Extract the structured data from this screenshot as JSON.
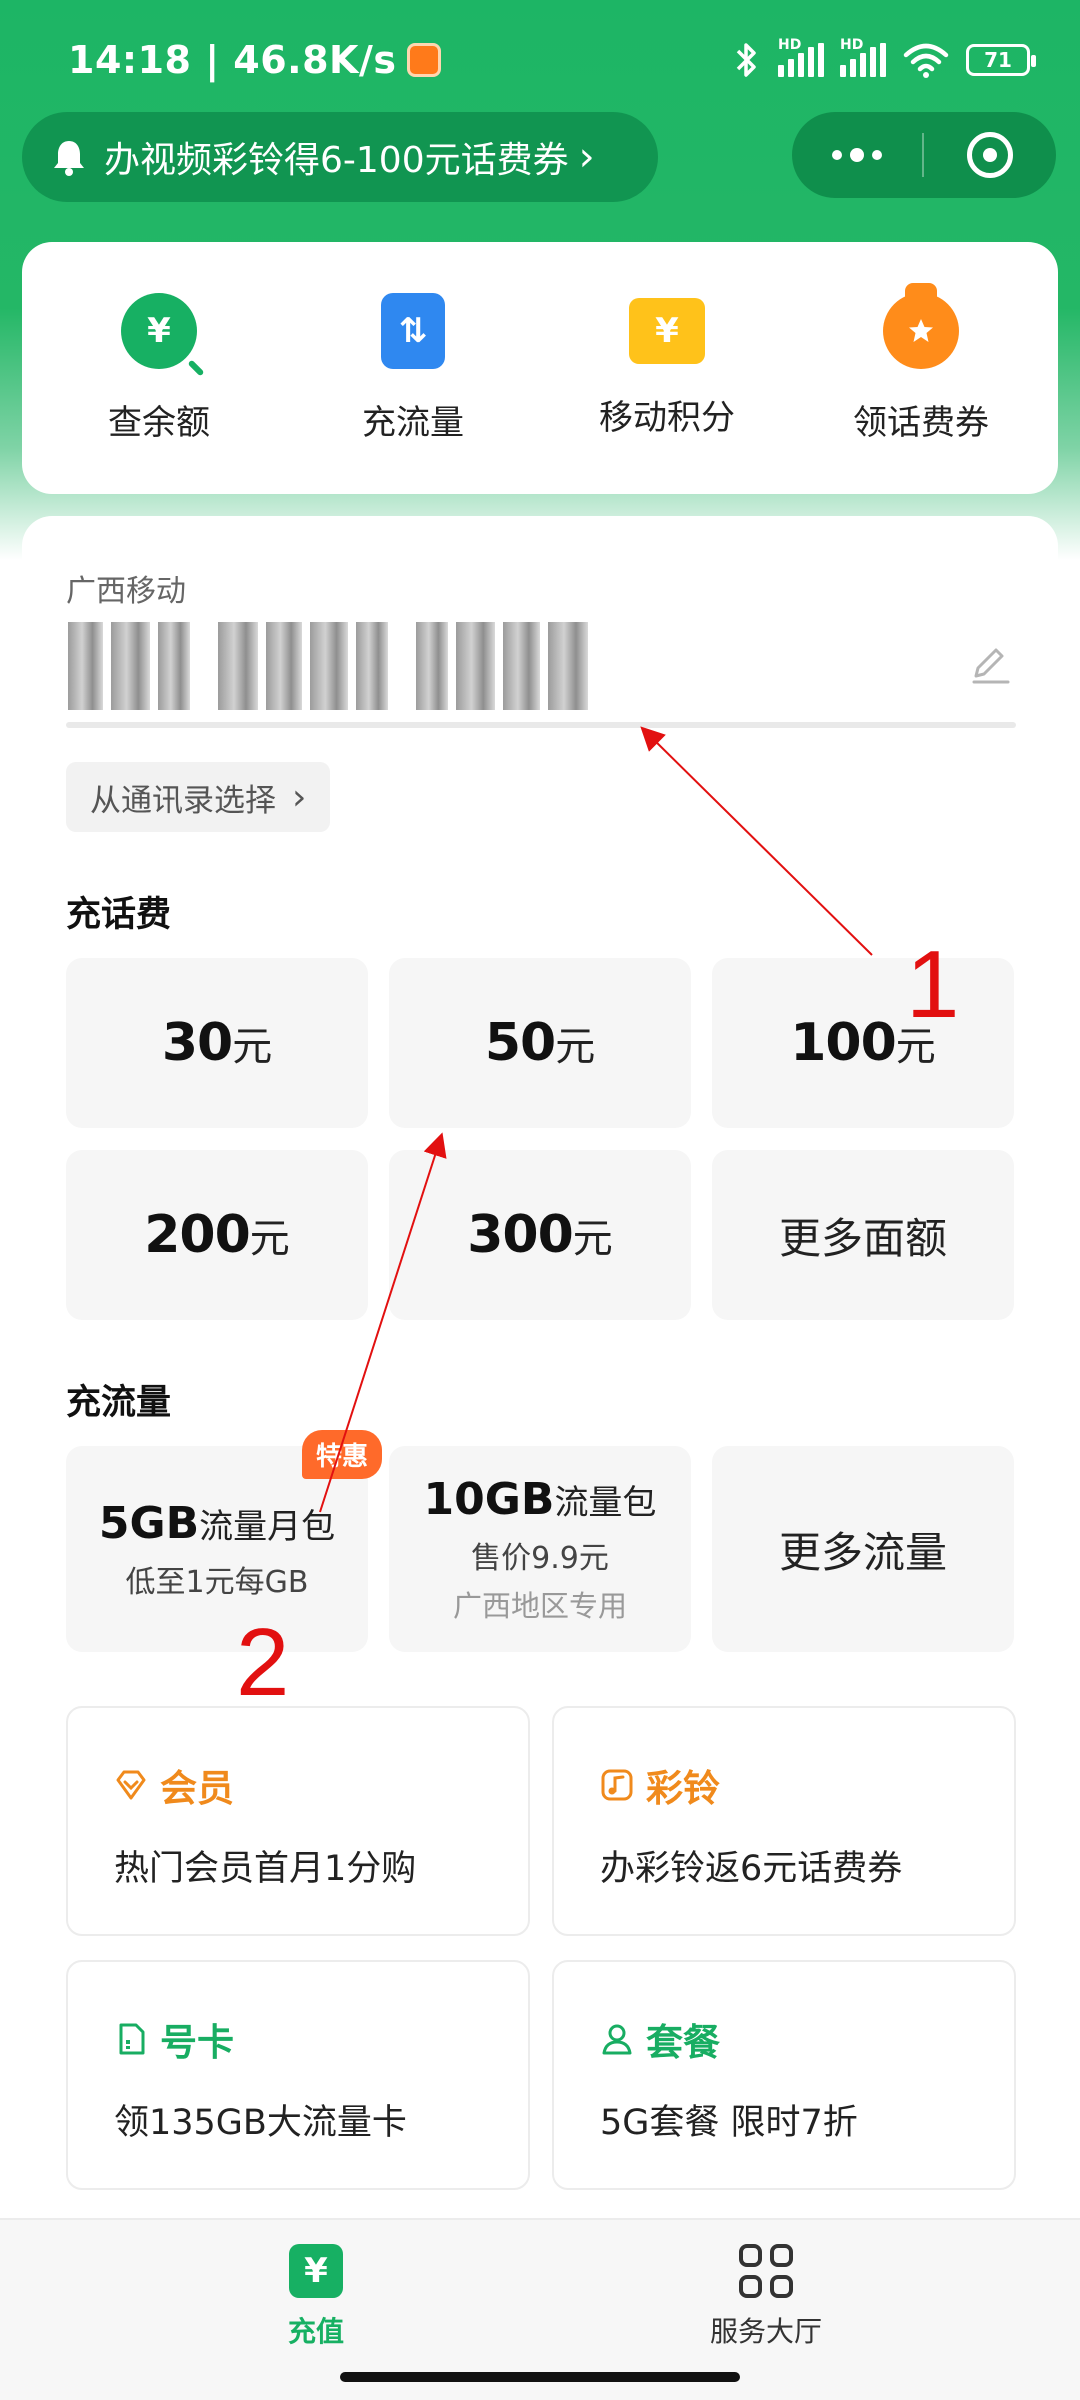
{
  "status_bar": {
    "time_speed": "14:18 | 46.8K/s",
    "battery": "71",
    "hd1": "HD",
    "hd2": "HD"
  },
  "notice": {
    "text": "办视频彩铃得6-100元话费券",
    "chevron": "›"
  },
  "quick_actions": [
    {
      "label": "查余额",
      "icon": "balance-yuan-icon"
    },
    {
      "label": "充流量",
      "icon": "data-transfer-icon"
    },
    {
      "label": "移动积分",
      "icon": "points-ticket-icon"
    },
    {
      "label": "领话费券",
      "icon": "coupon-bag-icon"
    }
  ],
  "account": {
    "carrier": "广西移动",
    "contacts_button": "从通讯录选择",
    "chevron": "›"
  },
  "recharge": {
    "title": "充话费",
    "unit": "元",
    "tiles": [
      {
        "amount": "30",
        "unit": "元"
      },
      {
        "amount": "50",
        "unit": "元"
      },
      {
        "amount": "100",
        "unit": "元"
      },
      {
        "amount": "200",
        "unit": "元"
      },
      {
        "amount": "300",
        "unit": "元"
      }
    ],
    "more": "更多面额"
  },
  "data_plans": {
    "title": "充流量",
    "items": [
      {
        "size": "5GB",
        "name": "流量月包",
        "sub": "低至1元每GB",
        "badge": "特惠"
      },
      {
        "size": "10GB",
        "name": "流量包",
        "sub": "售价9.9元",
        "sub2": "广西地区专用"
      }
    ],
    "more": "更多流量"
  },
  "promos": [
    {
      "title": "会员",
      "text": "热门会员首月1分购",
      "icon": "vip-diamond-icon",
      "color": "#f08a1c"
    },
    {
      "title": "彩铃",
      "text": "办彩铃返6元话费券",
      "icon": "music-note-icon",
      "color": "#f08a1c"
    },
    {
      "title": "号卡",
      "text": "领135GB大流量卡",
      "icon": "sim-card-icon",
      "color": "#18ad62"
    },
    {
      "title": "套餐",
      "text": "5G套餐 限时7折",
      "icon": "user-plan-icon",
      "color": "#18ad62"
    }
  ],
  "bottom_nav": [
    {
      "label": "充值",
      "glyph": "¥",
      "active": true
    },
    {
      "label": "服务大厅",
      "active": false
    }
  ],
  "glyphs": {
    "yuan": "¥",
    "updown": "⇅"
  },
  "annotations": {
    "one": "1",
    "two": "2"
  },
  "colors": {
    "brand_green": "#17b063",
    "accent_orange": "#f08a1c",
    "badge_orange": "#ff6a2a",
    "annotation_red": "#e21010"
  }
}
